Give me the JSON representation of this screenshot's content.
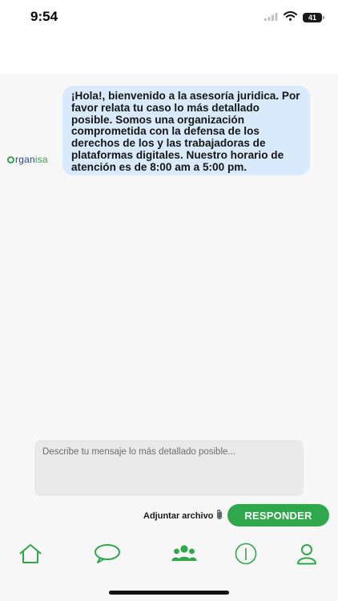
{
  "status_bar": {
    "time": "9:54",
    "battery": "41",
    "icons": [
      "signal-icon",
      "wifi-icon",
      "battery-icon"
    ]
  },
  "chat": {
    "brand_prefix": "rgan",
    "brand_accent": "isa",
    "bot_message": "¡Hola!, bienvenido a la asesoría juridica. Por favor relata tu caso lo más detallado posible. Somos una organización comprometida con la defensa de los derechos de los y las trabajadoras de plataformas digitales. Nuestro horario de atención es de 8:00 am a 5:00 pm."
  },
  "composer": {
    "placeholder": "Describe tu mensaje lo más detallado posible...",
    "value": "",
    "attach_label": "Adjuntar archivo",
    "send_label": "RESPONDER"
  },
  "tab_bar": {
    "items": [
      "home-icon",
      "chat-bubble-icon",
      "community-icon",
      "info-icon",
      "profile-icon"
    ],
    "active_color": "#2ea84a"
  },
  "colors": {
    "accent": "#2ea84a",
    "bubble": "#d9eafc",
    "brand_blue": "#1f4e8c"
  }
}
